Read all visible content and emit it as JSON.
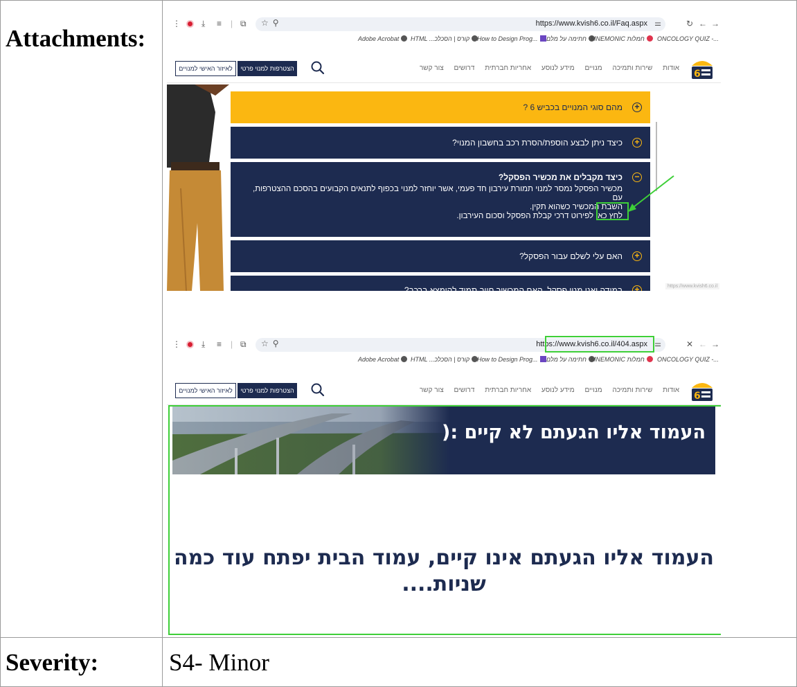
{
  "rows": {
    "attachments_label": "Attachments:",
    "severity_label": "Severity:",
    "severity_value": "S4- Minor"
  },
  "browser": {
    "bookmarks": [
      "Adobe Acrobat",
      "HTML ...קורס | הסכלכ",
      "How to Design Prog...",
      "חתימה על מלם",
      "MNEMONIC חמלות",
      "ONCOLOGY QUIZ -..."
    ]
  },
  "site_nav": {
    "links": [
      "אודות",
      "שירות ותמיכה",
      "מנויים",
      "מידע לנוסע",
      "אחריות חברתית",
      "דרושים",
      "צור קשר"
    ],
    "join_button": "הצטרפות למנוי פרטי",
    "personal_area_button": "לאיזור האישי למנויים"
  },
  "screenshot_faq": {
    "url": "https://www.kvish6.co.il/Faq.aspx",
    "questions": [
      "מהם סוגי המנויים בכביש 6 ?",
      "כיצד ניתן לבצע הוספת/הסרת רכב בחשבון המנוי?",
      "כיצד מקבלים את מכשיר הפסקל?",
      "האם עלי לשלם עבור הפסקל?",
      "במידה ואני מנוי פסקל, האם המכשיר חייב תמיד להימצא ברכב?"
    ],
    "answer_line1": "מכשיר הפסקל נמסר למנוי תמורת עירבון חד פעמי, אשר יוחזר למנוי בכפוף לתנאים הקבועים בהסכם ההצטרפות, עם",
    "answer_line2": "השבת המכשיר כשהוא תקין.",
    "answer_link": "לחץ כאן",
    "answer_line3": "לפירוט דרכי קבלת הפסקל וסכום העירבון.",
    "status_url": "https://www.kvish6.co.il"
  },
  "screenshot_404": {
    "url": "https://www.kvish6.co.il/404.aspx",
    "hero_title": "העמוד אליו הגעתם לא קיים :(",
    "message": "העמוד אליו הגעתם אינו קיים, עמוד הבית יפתח עוד כמה שניות...."
  },
  "colors": {
    "navy": "#1d2b50",
    "yellow": "#fbb711",
    "highlight_green": "#3ecf38"
  }
}
